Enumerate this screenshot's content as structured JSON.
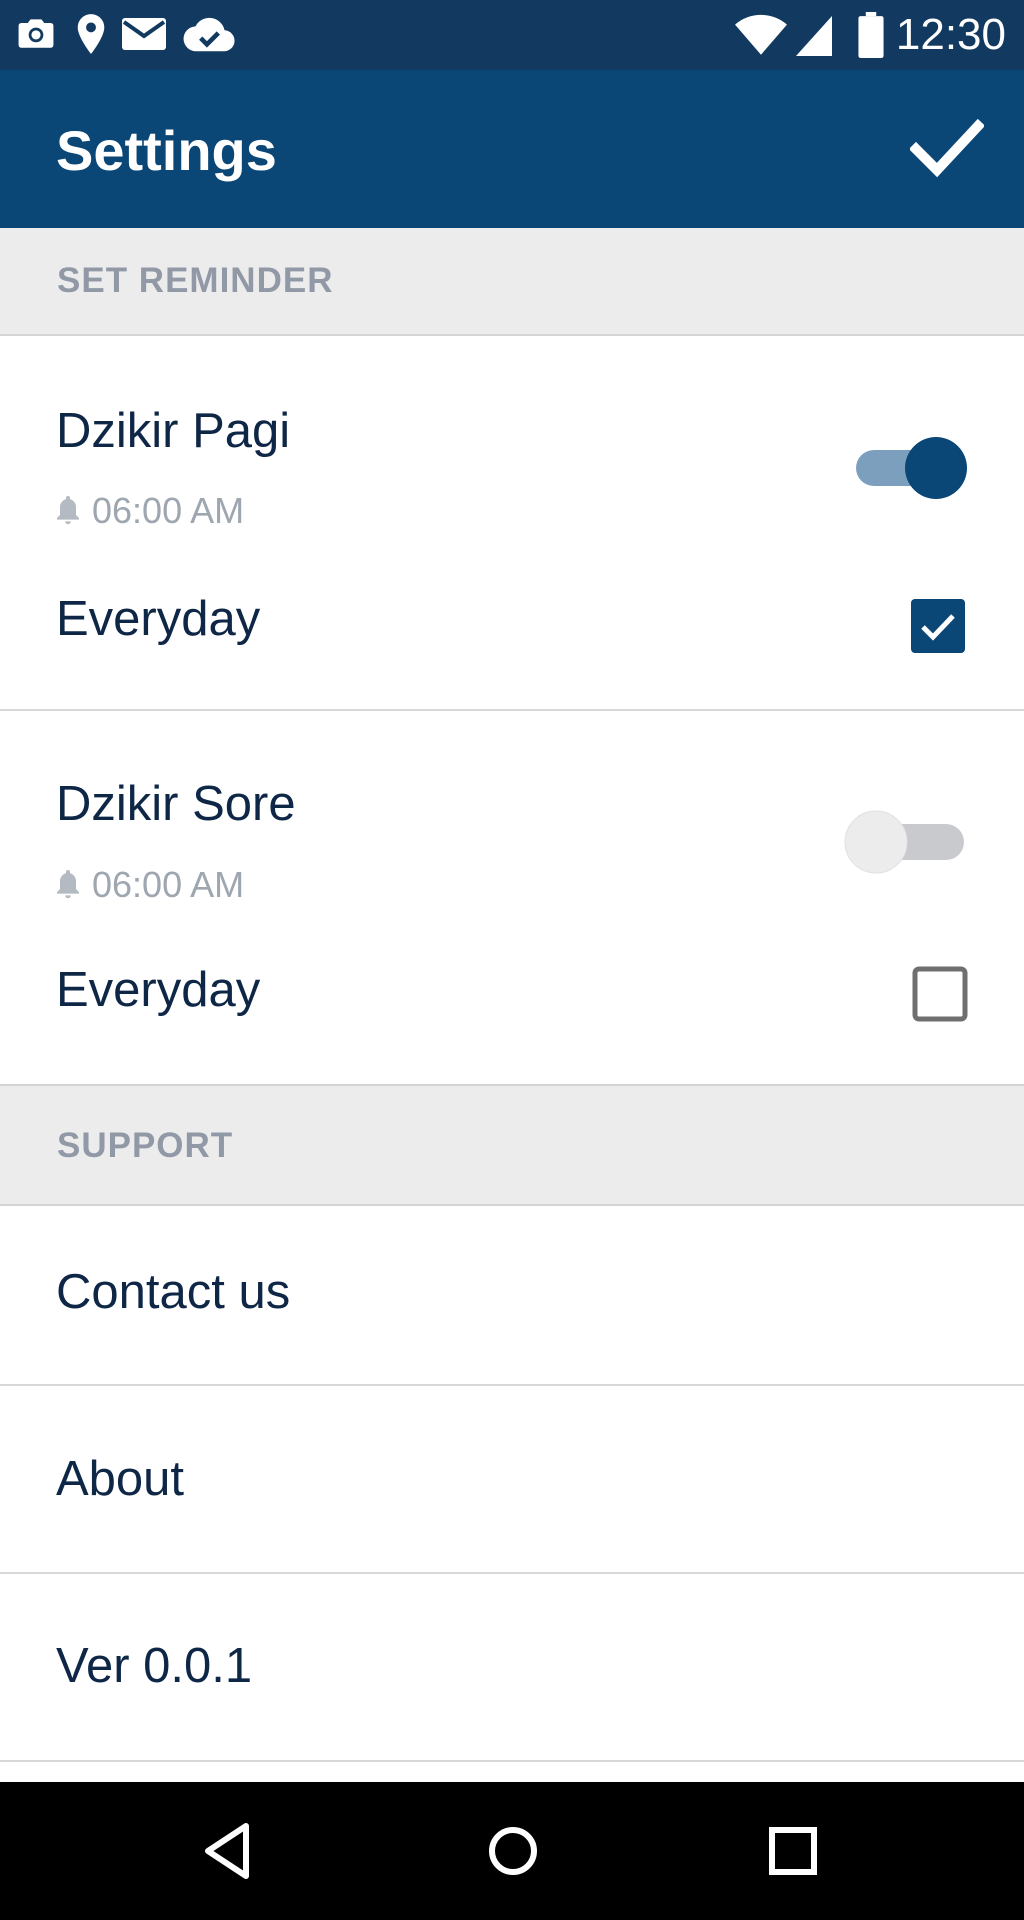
{
  "status_bar": {
    "left_icons": [
      "camera-icon",
      "location-pin-icon",
      "mail-icon",
      "cloud-done-icon"
    ],
    "right_icons": [
      "wifi-icon",
      "cellular-signal-icon",
      "battery-icon"
    ],
    "time": "12:30"
  },
  "app_bar": {
    "title": "Settings",
    "action_icon": "check-icon"
  },
  "sections": {
    "reminder": {
      "title": "SET REMINDER"
    },
    "support": {
      "title": "SUPPORT"
    }
  },
  "reminders": [
    {
      "title": "Dzikir Pagi",
      "alarm_icon": "bell-icon",
      "time": "06:00 AM",
      "enabled": true,
      "repeat_label": "Everyday",
      "everyday_checked": true
    },
    {
      "title": "Dzikir Sore",
      "alarm_icon": "bell-icon",
      "time": "06:00 AM",
      "enabled": false,
      "repeat_label": "Everyday",
      "everyday_checked": false
    }
  ],
  "support_items": {
    "contact": "Contact us",
    "about": "About",
    "version": "Ver 0.0.1"
  },
  "nav_bar": {
    "buttons": [
      "back-icon",
      "home-icon",
      "recents-icon"
    ]
  },
  "colors": {
    "status_bar": "#123a60",
    "app_bar": "#0a4676",
    "accent": "#0a4676",
    "switch_on_track": "#7d9fbe",
    "switch_off_track": "#c9cace",
    "section_bg": "#ececec",
    "text_primary": "#0f2746",
    "text_secondary": "#9ea6b0"
  }
}
